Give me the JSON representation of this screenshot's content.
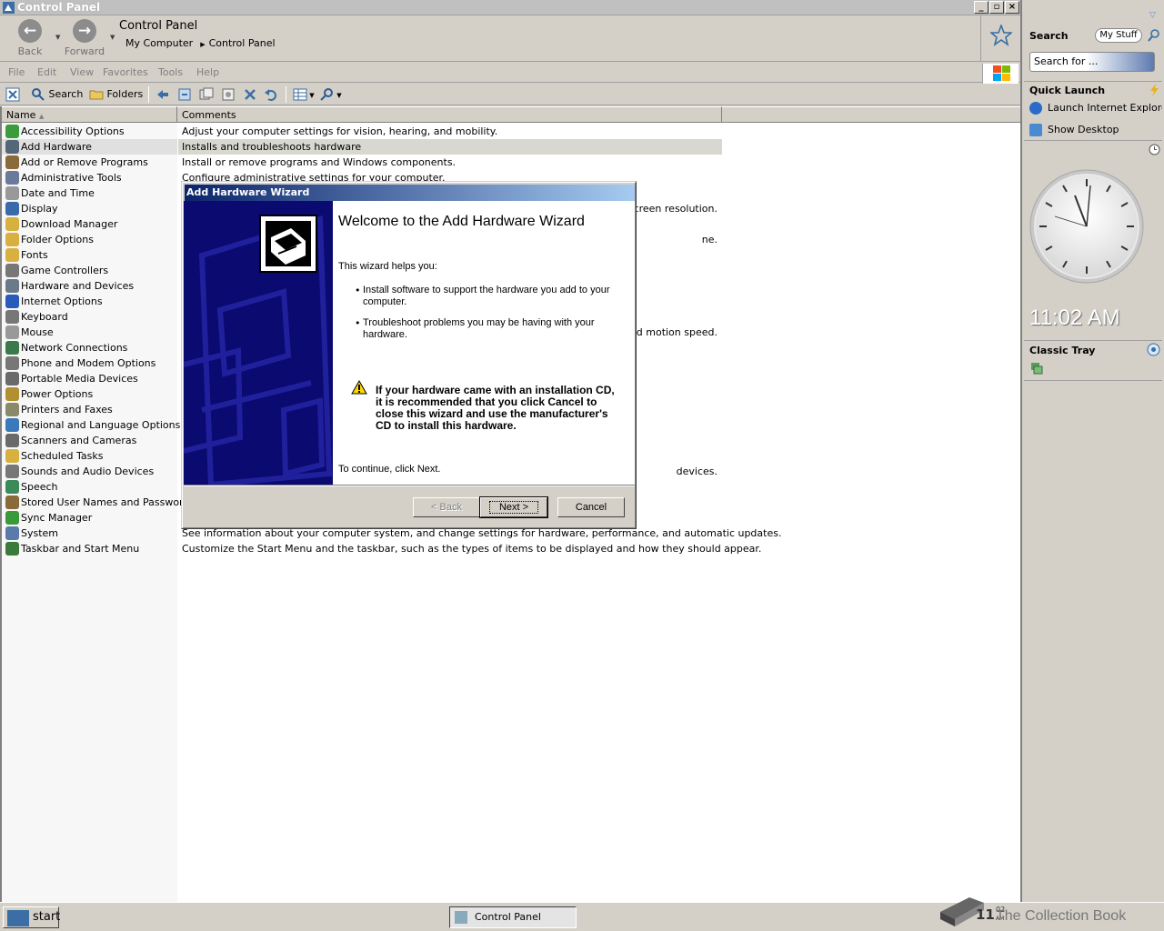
{
  "window": {
    "title": "Control Panel",
    "nav": {
      "back": "Back",
      "forward": "Forward"
    },
    "address_title": "Control Panel",
    "breadcrumb": [
      "My Computer",
      "Control Panel"
    ],
    "menu": [
      "File",
      "Edit",
      "View",
      "Favorites",
      "Tools",
      "Help"
    ],
    "toolbar": {
      "search": "Search",
      "folders": "Folders"
    }
  },
  "list": {
    "headers": {
      "name": "Name",
      "comments": "Comments"
    },
    "items": [
      {
        "name": "Accessibility Options",
        "comment": "Adjust your computer settings for vision, hearing, and mobility.",
        "color": "#3c9c3c"
      },
      {
        "name": "Add Hardware",
        "comment": "Installs and troubleshoots hardware",
        "color": "#556677"
      },
      {
        "name": "Add or Remove Programs",
        "comment": "Install or remove programs and Windows components.",
        "color": "#8a6a3a"
      },
      {
        "name": "Administrative Tools",
        "comment": "Configure administrative settings for your computer.",
        "color": "#6a7a9a"
      },
      {
        "name": "Date and Time",
        "comment": "",
        "color": "#999999"
      },
      {
        "name": "Display",
        "comment": "screen resolution.",
        "color": "#3a6aaa"
      },
      {
        "name": "Download Manager",
        "comment": "",
        "color": "#d8b040"
      },
      {
        "name": "Folder Options",
        "comment": "ne.",
        "color": "#d8b040"
      },
      {
        "name": "Fonts",
        "comment": "",
        "color": "#d8b040"
      },
      {
        "name": "Game Controllers",
        "comment": "",
        "color": "#777777"
      },
      {
        "name": "Hardware and Devices",
        "comment": "",
        "color": "#6a7a8a"
      },
      {
        "name": "Internet Options",
        "comment": "",
        "color": "#2a5aba"
      },
      {
        "name": "Keyboard",
        "comment": "",
        "color": "#777777"
      },
      {
        "name": "Mouse",
        "comment": "nd motion speed.",
        "color": "#999999"
      },
      {
        "name": "Network Connections",
        "comment": "",
        "color": "#3a7a4a"
      },
      {
        "name": "Phone and Modem Options",
        "comment": "",
        "color": "#777777"
      },
      {
        "name": "Portable Media Devices",
        "comment": "",
        "color": "#6a6a6a"
      },
      {
        "name": "Power Options",
        "comment": "",
        "color": "#b09030"
      },
      {
        "name": "Printers and Faxes",
        "comment": "",
        "color": "#8a8a6a"
      },
      {
        "name": "Regional and Language Options",
        "comment": "",
        "color": "#3a7aba"
      },
      {
        "name": "Scanners and Cameras",
        "comment": "",
        "color": "#6a6a6a"
      },
      {
        "name": "Scheduled Tasks",
        "comment": "",
        "color": "#d8b040"
      },
      {
        "name": "Sounds and Audio Devices",
        "comment": "devices.",
        "color": "#777777"
      },
      {
        "name": "Speech",
        "comment": "",
        "color": "#3a8a5a"
      },
      {
        "name": "Stored User Names and Passwords",
        "comment": "",
        "color": "#8a6a3a"
      },
      {
        "name": "Sync Manager",
        "comment": "",
        "color": "#3a9a3a"
      },
      {
        "name": "System",
        "comment": "See information about your computer system, and change settings for hardware, performance, and automatic updates.",
        "color": "#5a7aaa"
      },
      {
        "name": "Taskbar and Start Menu",
        "comment": "Customize the Start Menu and the taskbar, such as the types of items to be displayed and how they should appear.",
        "color": "#3a7a3a"
      }
    ]
  },
  "dialog": {
    "title": "Add Hardware Wizard",
    "heading": "Welcome to the Add Hardware Wizard",
    "intro": "This wizard helps you:",
    "bullets": [
      "Install software to support the hardware you add to your computer.",
      "Troubleshoot problems you may be having with your hardware."
    ],
    "warning": "If your hardware came with an installation CD, it is recommended that you click Cancel to close this wizard and use the manufacturer's CD to install this hardware.",
    "continue": "To continue, click Next.",
    "buttons": {
      "back": "< Back",
      "next": "Next >",
      "cancel": "Cancel"
    }
  },
  "sidebar": {
    "search_title": "Search",
    "my_stuff": "My Stuff",
    "search_placeholder": "Search for ...",
    "quick_launch_title": "Quick Launch",
    "quick_launch": [
      "Launch Internet Explorer",
      "Show Desktop"
    ],
    "time": "11:02 AM",
    "classic_tray_title": "Classic Tray"
  },
  "taskbar": {
    "start": "start",
    "task": "Control Panel",
    "watermark": "The Collection Book",
    "clock_hour": "11",
    "clock_min": "02",
    "clock_ampm": "AM"
  }
}
